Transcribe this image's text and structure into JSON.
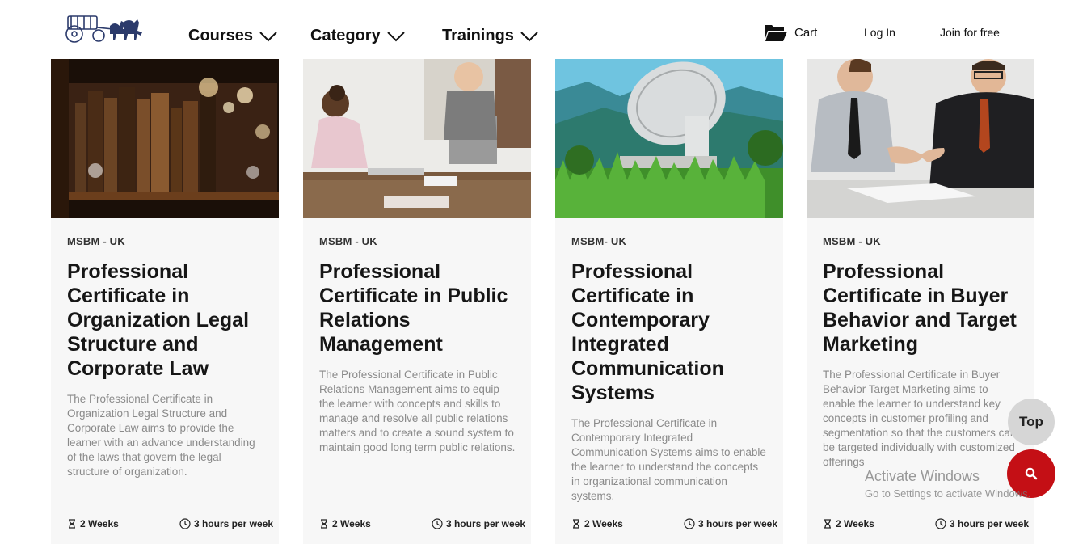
{
  "header": {
    "logo_icon": "carriage-logo",
    "nav": [
      {
        "label": "Courses"
      },
      {
        "label": "Category"
      },
      {
        "label": "Trainings"
      }
    ],
    "cart_label": "Cart",
    "login_label": "Log In",
    "join_label": "Join for free"
  },
  "cards": [
    {
      "provider": "MSBM - UK",
      "title": "Professional Certificate in Organization Legal Structure and Corporate Law",
      "description": "The Professional Certificate in Organization Legal Structure and Corporate Law aims to provide the learner with an advance understanding of the laws that govern the legal structure of organization.",
      "duration": "2 Weeks",
      "hours": "3 hours per week",
      "image": "library-books"
    },
    {
      "provider": "MSBM - UK",
      "title": "Professional Certificate in Public Relations Management",
      "description": "The Professional Certificate in Public Relations Management aims to equip the learner with concepts and skills to manage and resolve all public relations matters and to create a sound system to maintain good long term public relations.",
      "duration": "2 Weeks",
      "hours": "3 hours per week",
      "image": "office-meeting"
    },
    {
      "provider": "MSBM- UK",
      "title": "Professional Certificate in Contemporary Integrated Communication Systems",
      "description": "The Professional Certificate in Contemporary Integrated Communication Systems aims to enable the learner to understand the concepts in organizational communication systems.",
      "duration": "2 Weeks",
      "hours": "3 hours per week",
      "image": "satellite-dish"
    },
    {
      "provider": "MSBM - UK",
      "title": "Professional Certificate in Buyer Behavior and Target Marketing",
      "description": "The Professional Certificate in Buyer Behavior Target Marketing aims to enable the learner to understand key concepts in customer profiling and segmentation so that the customers can be targeted individually with customized offerings",
      "duration": "2 Weeks",
      "hours": "3 hours per week",
      "image": "business-handshake"
    }
  ],
  "top_button_label": "Top",
  "search_button_icon": "search-icon",
  "watermark": {
    "line1": "Activate Windows",
    "line2": "Go to Settings to activate Windows."
  },
  "colors": {
    "accent_red": "#c40f15",
    "card_bg": "#f7f7f7",
    "desc_text": "#8a8a8a"
  }
}
